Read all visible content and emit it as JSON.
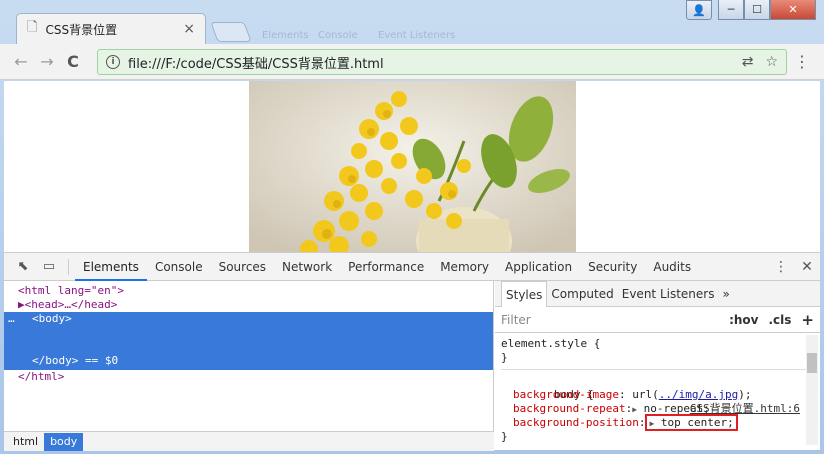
{
  "browser": {
    "tab_title": "CSS背景位置",
    "tab_close": "×",
    "ghost_tabs": [
      "Elements",
      "Console",
      "Event Listeners"
    ],
    "window_buttons": [
      "👤",
      "─",
      "☐",
      "✕"
    ],
    "nav": {
      "back": "←",
      "forward": "→",
      "reload": "C"
    },
    "url": "file:///F:/code/CSS基础/CSS背景位置.html",
    "info_glyph": "i",
    "translate_glyph": "⇄",
    "star_glyph": "☆",
    "menu_glyph": "⋮"
  },
  "devtools": {
    "inspect_glyph": "⬉",
    "device_glyph": "▭",
    "tabs": [
      "Elements",
      "Console",
      "Sources",
      "Network",
      "Performance",
      "Memory",
      "Application",
      "Security",
      "Audits"
    ],
    "active_tab": "Elements",
    "more_glyph": "⋮",
    "close_glyph": "✕",
    "dom": {
      "html_open": "<html lang=\"en\">",
      "head": "▶<head>…</head>",
      "body_open": "<body>",
      "body_close": "</body> == $0",
      "html_close": "</html>",
      "ellipsis": "…"
    },
    "breadcrumbs": [
      "html",
      "body"
    ],
    "styles": {
      "tabs": [
        "Styles",
        "Computed",
        "Event Listeners",
        "»"
      ],
      "filter_placeholder": "Filter",
      "hov": ":hov",
      "cls": ".cls",
      "plus": "+",
      "element_style": "element.style {",
      "close_brace": "}",
      "body_selector": "body {",
      "source": "CSS背景位置.html:6",
      "rules": [
        {
          "prop": "background-image",
          "value_prefix": " url(",
          "link": "../img/a.jpg",
          "value_suffix": ");"
        },
        {
          "prop": "background-repeat",
          "value": "no-repeat;"
        },
        {
          "prop": "background-position",
          "value": "top center;"
        }
      ]
    }
  }
}
